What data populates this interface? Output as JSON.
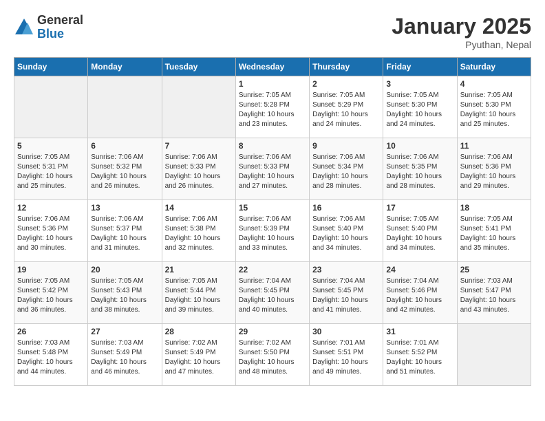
{
  "header": {
    "logo_general": "General",
    "logo_blue": "Blue",
    "month_title": "January 2025",
    "location": "Pyuthan, Nepal"
  },
  "days_of_week": [
    "Sunday",
    "Monday",
    "Tuesday",
    "Wednesday",
    "Thursday",
    "Friday",
    "Saturday"
  ],
  "weeks": [
    [
      {
        "day": "",
        "sunrise": "",
        "sunset": "",
        "daylight": ""
      },
      {
        "day": "",
        "sunrise": "",
        "sunset": "",
        "daylight": ""
      },
      {
        "day": "",
        "sunrise": "",
        "sunset": "",
        "daylight": ""
      },
      {
        "day": "1",
        "sunrise": "Sunrise: 7:05 AM",
        "sunset": "Sunset: 5:28 PM",
        "daylight": "Daylight: 10 hours and 23 minutes."
      },
      {
        "day": "2",
        "sunrise": "Sunrise: 7:05 AM",
        "sunset": "Sunset: 5:29 PM",
        "daylight": "Daylight: 10 hours and 24 minutes."
      },
      {
        "day": "3",
        "sunrise": "Sunrise: 7:05 AM",
        "sunset": "Sunset: 5:30 PM",
        "daylight": "Daylight: 10 hours and 24 minutes."
      },
      {
        "day": "4",
        "sunrise": "Sunrise: 7:05 AM",
        "sunset": "Sunset: 5:30 PM",
        "daylight": "Daylight: 10 hours and 25 minutes."
      }
    ],
    [
      {
        "day": "5",
        "sunrise": "Sunrise: 7:05 AM",
        "sunset": "Sunset: 5:31 PM",
        "daylight": "Daylight: 10 hours and 25 minutes."
      },
      {
        "day": "6",
        "sunrise": "Sunrise: 7:06 AM",
        "sunset": "Sunset: 5:32 PM",
        "daylight": "Daylight: 10 hours and 26 minutes."
      },
      {
        "day": "7",
        "sunrise": "Sunrise: 7:06 AM",
        "sunset": "Sunset: 5:33 PM",
        "daylight": "Daylight: 10 hours and 26 minutes."
      },
      {
        "day": "8",
        "sunrise": "Sunrise: 7:06 AM",
        "sunset": "Sunset: 5:33 PM",
        "daylight": "Daylight: 10 hours and 27 minutes."
      },
      {
        "day": "9",
        "sunrise": "Sunrise: 7:06 AM",
        "sunset": "Sunset: 5:34 PM",
        "daylight": "Daylight: 10 hours and 28 minutes."
      },
      {
        "day": "10",
        "sunrise": "Sunrise: 7:06 AM",
        "sunset": "Sunset: 5:35 PM",
        "daylight": "Daylight: 10 hours and 28 minutes."
      },
      {
        "day": "11",
        "sunrise": "Sunrise: 7:06 AM",
        "sunset": "Sunset: 5:36 PM",
        "daylight": "Daylight: 10 hours and 29 minutes."
      }
    ],
    [
      {
        "day": "12",
        "sunrise": "Sunrise: 7:06 AM",
        "sunset": "Sunset: 5:36 PM",
        "daylight": "Daylight: 10 hours and 30 minutes."
      },
      {
        "day": "13",
        "sunrise": "Sunrise: 7:06 AM",
        "sunset": "Sunset: 5:37 PM",
        "daylight": "Daylight: 10 hours and 31 minutes."
      },
      {
        "day": "14",
        "sunrise": "Sunrise: 7:06 AM",
        "sunset": "Sunset: 5:38 PM",
        "daylight": "Daylight: 10 hours and 32 minutes."
      },
      {
        "day": "15",
        "sunrise": "Sunrise: 7:06 AM",
        "sunset": "Sunset: 5:39 PM",
        "daylight": "Daylight: 10 hours and 33 minutes."
      },
      {
        "day": "16",
        "sunrise": "Sunrise: 7:06 AM",
        "sunset": "Sunset: 5:40 PM",
        "daylight": "Daylight: 10 hours and 34 minutes."
      },
      {
        "day": "17",
        "sunrise": "Sunrise: 7:05 AM",
        "sunset": "Sunset: 5:40 PM",
        "daylight": "Daylight: 10 hours and 34 minutes."
      },
      {
        "day": "18",
        "sunrise": "Sunrise: 7:05 AM",
        "sunset": "Sunset: 5:41 PM",
        "daylight": "Daylight: 10 hours and 35 minutes."
      }
    ],
    [
      {
        "day": "19",
        "sunrise": "Sunrise: 7:05 AM",
        "sunset": "Sunset: 5:42 PM",
        "daylight": "Daylight: 10 hours and 36 minutes."
      },
      {
        "day": "20",
        "sunrise": "Sunrise: 7:05 AM",
        "sunset": "Sunset: 5:43 PM",
        "daylight": "Daylight: 10 hours and 38 minutes."
      },
      {
        "day": "21",
        "sunrise": "Sunrise: 7:05 AM",
        "sunset": "Sunset: 5:44 PM",
        "daylight": "Daylight: 10 hours and 39 minutes."
      },
      {
        "day": "22",
        "sunrise": "Sunrise: 7:04 AM",
        "sunset": "Sunset: 5:45 PM",
        "daylight": "Daylight: 10 hours and 40 minutes."
      },
      {
        "day": "23",
        "sunrise": "Sunrise: 7:04 AM",
        "sunset": "Sunset: 5:45 PM",
        "daylight": "Daylight: 10 hours and 41 minutes."
      },
      {
        "day": "24",
        "sunrise": "Sunrise: 7:04 AM",
        "sunset": "Sunset: 5:46 PM",
        "daylight": "Daylight: 10 hours and 42 minutes."
      },
      {
        "day": "25",
        "sunrise": "Sunrise: 7:03 AM",
        "sunset": "Sunset: 5:47 PM",
        "daylight": "Daylight: 10 hours and 43 minutes."
      }
    ],
    [
      {
        "day": "26",
        "sunrise": "Sunrise: 7:03 AM",
        "sunset": "Sunset: 5:48 PM",
        "daylight": "Daylight: 10 hours and 44 minutes."
      },
      {
        "day": "27",
        "sunrise": "Sunrise: 7:03 AM",
        "sunset": "Sunset: 5:49 PM",
        "daylight": "Daylight: 10 hours and 46 minutes."
      },
      {
        "day": "28",
        "sunrise": "Sunrise: 7:02 AM",
        "sunset": "Sunset: 5:49 PM",
        "daylight": "Daylight: 10 hours and 47 minutes."
      },
      {
        "day": "29",
        "sunrise": "Sunrise: 7:02 AM",
        "sunset": "Sunset: 5:50 PM",
        "daylight": "Daylight: 10 hours and 48 minutes."
      },
      {
        "day": "30",
        "sunrise": "Sunrise: 7:01 AM",
        "sunset": "Sunset: 5:51 PM",
        "daylight": "Daylight: 10 hours and 49 minutes."
      },
      {
        "day": "31",
        "sunrise": "Sunrise: 7:01 AM",
        "sunset": "Sunset: 5:52 PM",
        "daylight": "Daylight: 10 hours and 51 minutes."
      },
      {
        "day": "",
        "sunrise": "",
        "sunset": "",
        "daylight": ""
      }
    ]
  ]
}
